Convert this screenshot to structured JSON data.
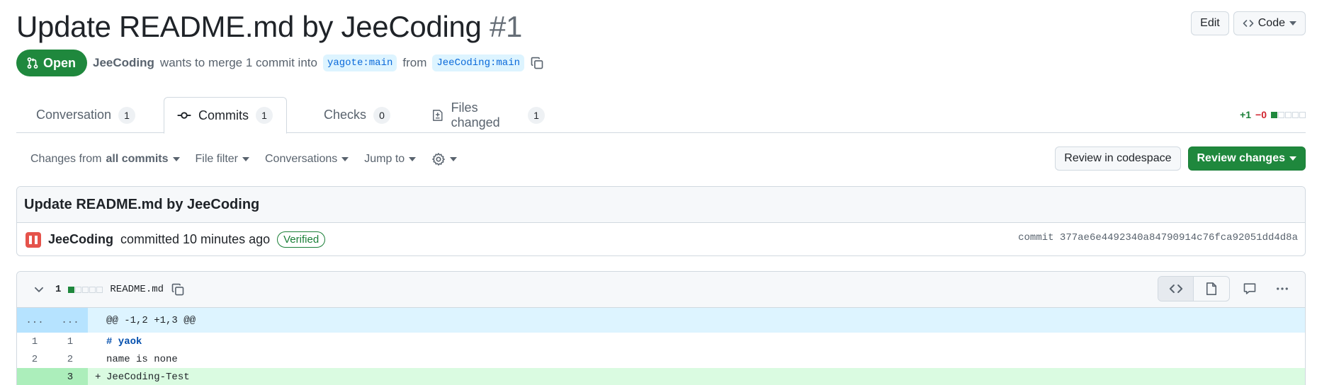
{
  "pr": {
    "title": "Update README.md by JeeCoding",
    "number": "#1",
    "state": "Open",
    "author": "JeeCoding",
    "merge_text": "wants to merge 1 commit into",
    "base_branch": "yagote:main",
    "from_text": "from",
    "head_branch": "JeeCoding:main"
  },
  "header_actions": {
    "edit": "Edit",
    "code": "Code"
  },
  "tabs": [
    {
      "label": "Conversation",
      "count": "1",
      "icon": "comment-discussion-icon"
    },
    {
      "label": "Commits",
      "count": "1",
      "icon": "git-commit-icon"
    },
    {
      "label": "Checks",
      "count": "0",
      "icon": "checklist-icon"
    },
    {
      "label": "Files changed",
      "count": "1",
      "icon": "file-diff-icon"
    }
  ],
  "diffstat": {
    "additions": "+1",
    "deletions": "−0"
  },
  "toolbar": {
    "changes_from": "Changes from",
    "changes_value": "all commits",
    "file_filter": "File filter",
    "conversations": "Conversations",
    "jump_to": "Jump to",
    "review_codespace": "Review in codespace",
    "review_changes": "Review changes"
  },
  "commit": {
    "message": "Update README.md by JeeCoding",
    "author": "JeeCoding",
    "action": "committed 10 minutes ago",
    "verified": "Verified",
    "sha_label": "commit 377ae6e4492340a84790914c76fca92051dd4d8a"
  },
  "file": {
    "change_count": "1",
    "name": "README.md",
    "hunk": "@@ -1,2 +1,3 @@",
    "hunk_left": "...",
    "hunk_right": "...",
    "lines": [
      {
        "old": "1",
        "new": "1",
        "marker": "",
        "text": "# yaok"
      },
      {
        "old": "2",
        "new": "2",
        "marker": "",
        "text": "name is none"
      },
      {
        "old": "",
        "new": "3",
        "marker": "+",
        "text": "JeeCoding-Test"
      }
    ]
  },
  "colors": {
    "accent_green": "#1f883d",
    "link_blue": "#0969da",
    "added_bg": "#dafbe1",
    "hunk_bg": "#ddf4ff"
  }
}
